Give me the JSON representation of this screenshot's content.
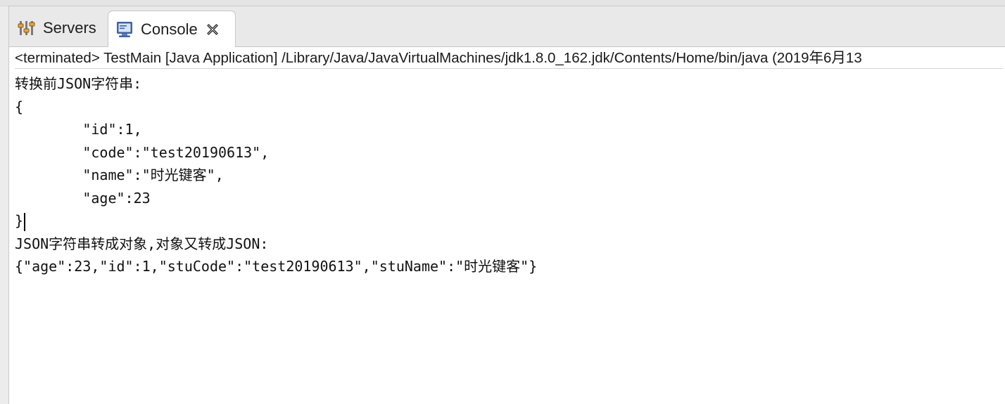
{
  "tabs": [
    {
      "label": "Servers",
      "icon": "servers-icon",
      "active": false
    },
    {
      "label": "Console",
      "icon": "console-icon",
      "active": true,
      "closable": true
    }
  ],
  "status": {
    "text": "<terminated> TestMain [Java Application] /Library/Java/JavaVirtualMachines/jdk1.8.0_162.jdk/Contents/Home/bin/java (2019年6月13"
  },
  "console": {
    "lines": [
      "转换前JSON字符串:",
      "{",
      "        \"id\":1,",
      "        \"code\":\"test20190613\",",
      "        \"name\":\"时光键客\",",
      "        \"age\":23",
      "}",
      "JSON字符串转成对象,对象又转成JSON:",
      "{\"age\":23,\"id\":1,\"stuCode\":\"test20190613\",\"stuName\":\"时光键客\"}"
    ]
  },
  "colors": {
    "active_tab_bg": "#ffffff",
    "tabbar_bg": "#e9e9e9",
    "console_icon_blue": "#3f63a8"
  }
}
